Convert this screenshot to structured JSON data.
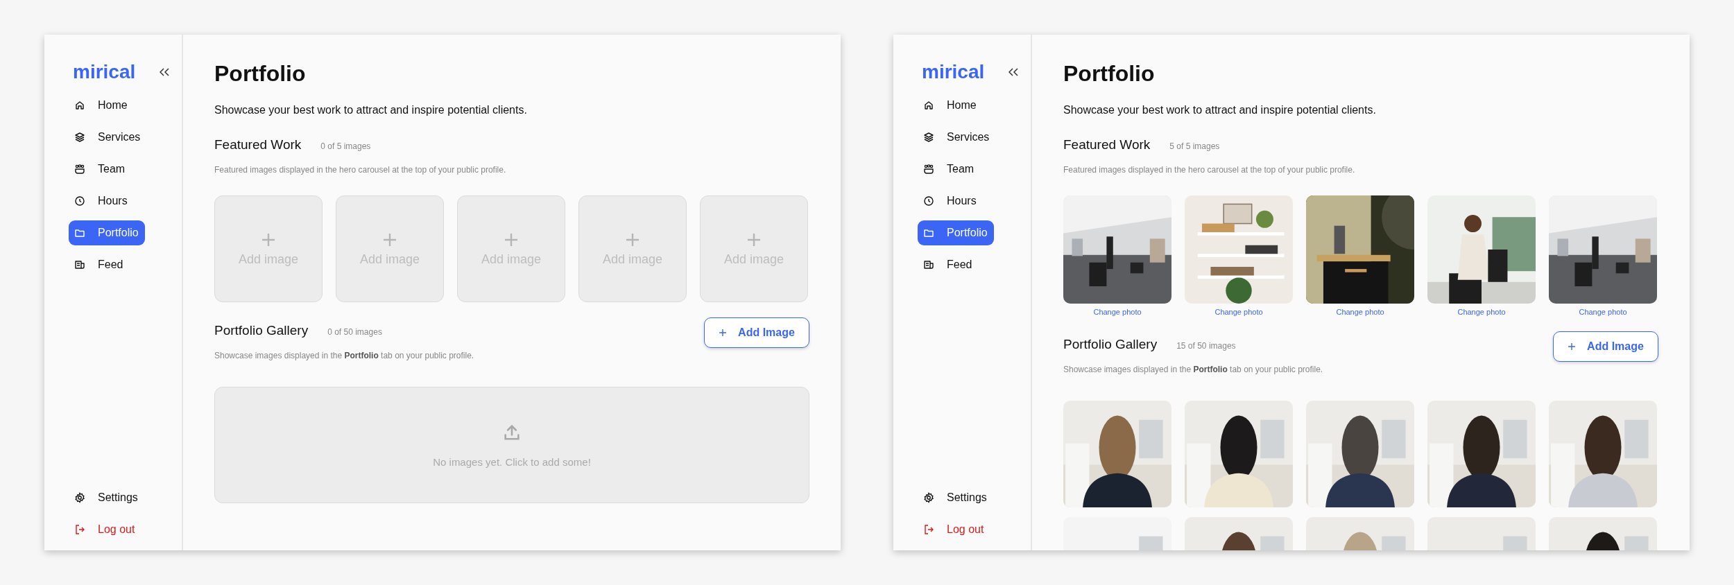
{
  "screens": [
    {
      "sidebar": {
        "logo": "mirical",
        "items": [
          {
            "label": "Home",
            "selected": false
          },
          {
            "label": "Services",
            "selected": false
          },
          {
            "label": "Team",
            "selected": false
          },
          {
            "label": "Hours",
            "selected": false
          },
          {
            "label": "Portfolio",
            "selected": true
          },
          {
            "label": "Feed",
            "selected": false
          }
        ],
        "bottom_items": [
          {
            "label": "Settings",
            "kind": "normal"
          },
          {
            "label": "Log out",
            "kind": "danger"
          }
        ]
      },
      "page": {
        "title": "Portfolio",
        "subtitle": "Showcase your best work to attract and inspire potential clients.",
        "featured": {
          "title": "Featured Work",
          "count": "0 of 5 images",
          "description": "Featured images displayed in the hero carousel at the top of your public profile.",
          "slots": [
            {
              "kind": "empty",
              "label": "Add image"
            },
            {
              "kind": "empty",
              "label": "Add image"
            },
            {
              "kind": "empty",
              "label": "Add image"
            },
            {
              "kind": "empty",
              "label": "Add image"
            },
            {
              "kind": "empty",
              "label": "Add image"
            }
          ]
        },
        "gallery": {
          "title": "Portfolio Gallery",
          "count": "0 of 50 images",
          "description": "Showcase images displayed in the **Portfolio** tab on your public profile.",
          "button": "Add Image",
          "empty_text": "No images yet. Click to add some!"
        }
      }
    },
    {
      "sidebar": {
        "logo": "mirical",
        "items": [
          {
            "label": "Home",
            "selected": false
          },
          {
            "label": "Services",
            "selected": false
          },
          {
            "label": "Team",
            "selected": false
          },
          {
            "label": "Hours",
            "selected": false
          },
          {
            "label": "Portfolio",
            "selected": true
          },
          {
            "label": "Feed",
            "selected": false
          }
        ],
        "bottom_items": [
          {
            "label": "Settings",
            "kind": "normal"
          },
          {
            "label": "Log out",
            "kind": "danger"
          }
        ]
      },
      "page": {
        "title": "Portfolio",
        "subtitle": "Showcase your best work to attract and inspire potential clients.",
        "featured": {
          "title": "Featured Work",
          "count": "5 of 5 images",
          "description": "Featured images displayed in the hero carousel at the top of your public profile.",
          "slots": [
            {
              "action": "Change photo"
            },
            {
              "action": "Change photo"
            },
            {
              "action": "Change photo"
            },
            {
              "action": "Change photo"
            },
            {
              "action": "Change photo"
            }
          ]
        },
        "gallery": {
          "title": "Portfolio Gallery",
          "count": "15 of 50 images",
          "description": "Showcase images displayed in the **Portfolio** tab on your public profile.",
          "button": "Add Image"
        }
      }
    }
  ]
}
